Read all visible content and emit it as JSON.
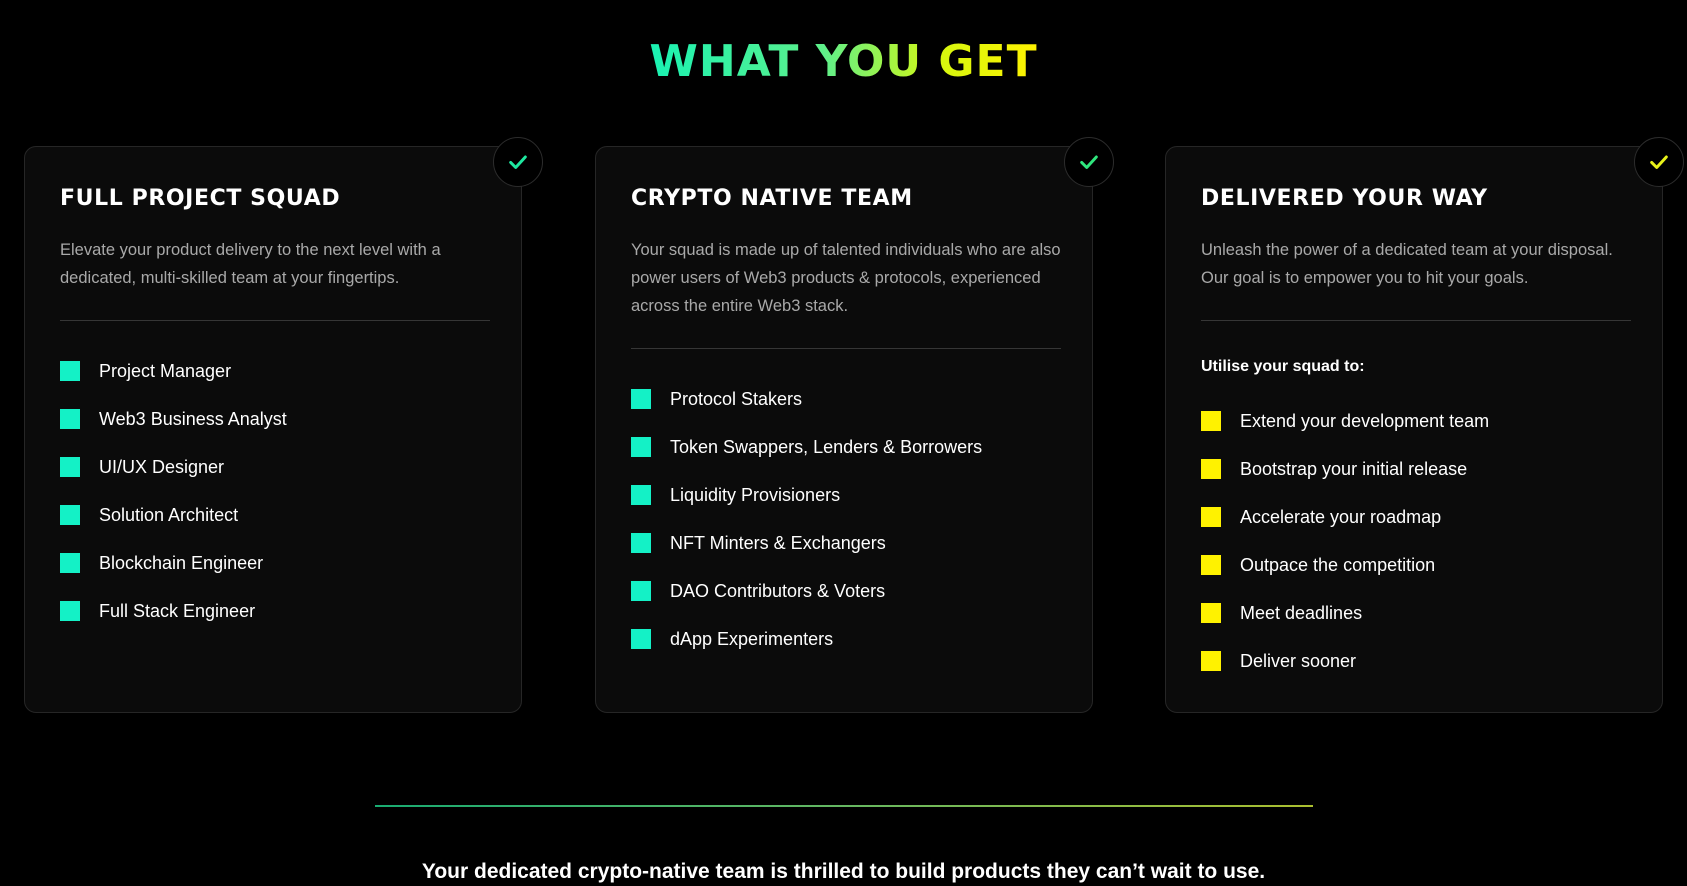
{
  "title": {
    "text": "WHAT YOU GET",
    "gradient": [
      "#19f2b3",
      "#fff200"
    ]
  },
  "colors": {
    "teal_accent": "#14f1c6",
    "green_check": "#1ee8a0",
    "yellow_accent": "#fff200",
    "card_background": "#0b0b0b"
  },
  "cards": [
    {
      "title": "FULL PROJECT SQUAD",
      "description": "Elevate your product delivery to the next level with a dedicated, multi-skilled team at your fingertips.",
      "badge_icon": "checkmark-icon",
      "badge_color": "#1ee8a0",
      "bullet_color": "#14f1c6",
      "items": [
        "Project Manager",
        "Web3 Business Analyst",
        "UI/UX Designer",
        "Solution Architect",
        "Blockchain Engineer",
        "Full Stack Engineer"
      ]
    },
    {
      "title": "CRYPTO NATIVE TEAM",
      "description": "Your squad is made up of talented individuals who are also power users of Web3 products & protocols, experienced across the entire Web3 stack.",
      "badge_icon": "checkmark-icon",
      "badge_color": "#2fe67d",
      "bullet_color": "#14f1c6",
      "items": [
        "Protocol Stakers",
        "Token Swappers, Lenders & Borrowers",
        "Liquidity Provisioners",
        "NFT Minters & Exchangers",
        "DAO Contributors & Voters",
        "dApp Experimenters"
      ]
    },
    {
      "title": "DELIVERED YOUR WAY",
      "description": "Unleash the power of a dedicated team at your disposal. Our goal is to empower you to hit your goals.",
      "subheading": "Utilise your squad to:",
      "badge_icon": "checkmark-icon",
      "badge_color": "#e8f21a",
      "bullet_color": "#fff200",
      "items": [
        "Extend your development team",
        "Bootstrap your initial release",
        "Accelerate your roadmap",
        "Outpace the competition",
        "Meet deadlines",
        "Deliver sooner"
      ]
    }
  ],
  "footer": {
    "tagline": "Your dedicated crypto-native team is thrilled to build products they can’t wait to use."
  }
}
